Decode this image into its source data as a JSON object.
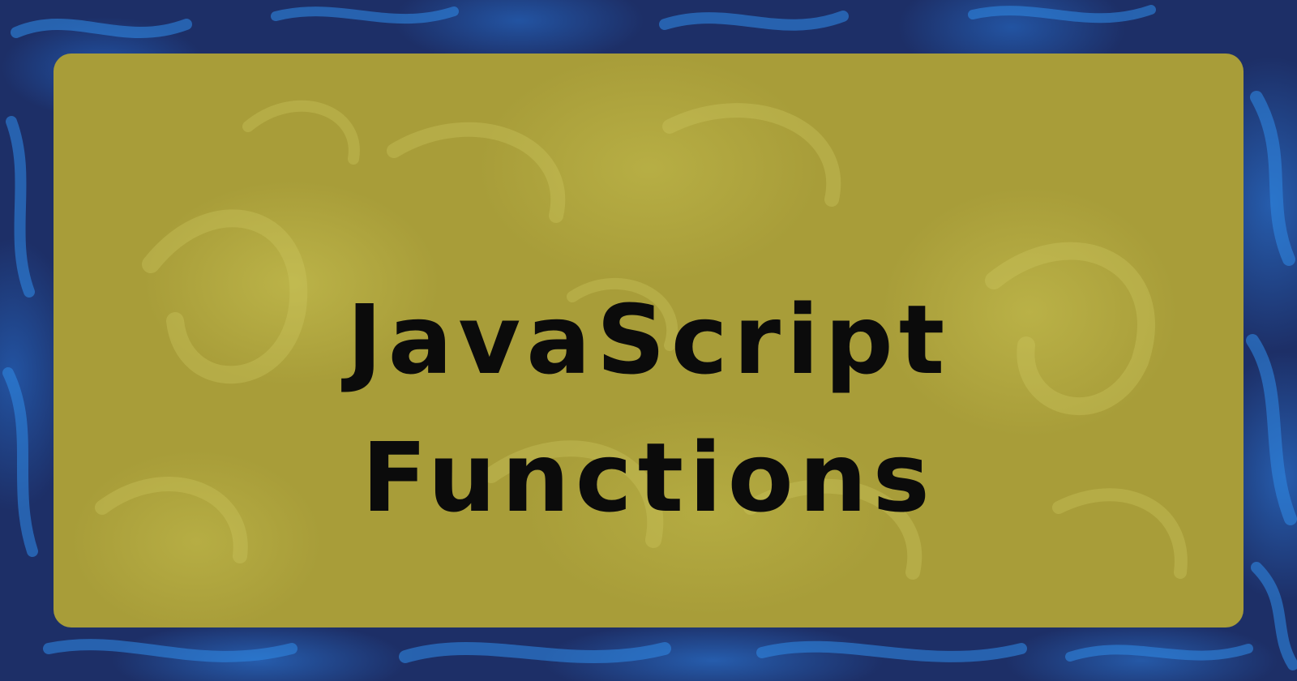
{
  "hero": {
    "title_line_1": "JavaScript",
    "title_line_2": "Functions"
  },
  "colors": {
    "background": "#1d2f67",
    "background_swirl": "#2a7fdc",
    "card": "#a89d39",
    "card_swirl": "#cfc860",
    "title_text": "#0b0b0b"
  }
}
